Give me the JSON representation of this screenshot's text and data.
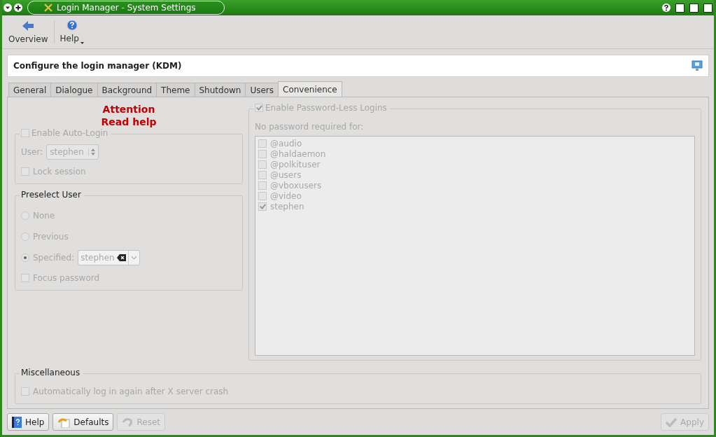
{
  "window": {
    "title": "Login Manager - System Settings"
  },
  "toolbar": [
    {
      "label": "Overview",
      "kind": "back"
    },
    {
      "label": "Help",
      "kind": "help"
    }
  ],
  "header": {
    "title": "Configure the login manager (KDM)"
  },
  "tabs": [
    {
      "label": "General",
      "selected": false
    },
    {
      "label": "Dialogue",
      "selected": false
    },
    {
      "label": "Background",
      "selected": false
    },
    {
      "label": "Theme",
      "selected": false
    },
    {
      "label": "Shutdown",
      "selected": false
    },
    {
      "label": "Users",
      "selected": false
    },
    {
      "label": "Convenience",
      "selected": true
    }
  ],
  "attention": [
    "Attention",
    "Read help"
  ],
  "auto_login": {
    "label": "Enable Auto-Login",
    "checked": false,
    "disabled": true,
    "user_label": "User:",
    "user_value": "stephen",
    "lock_session": {
      "label": "Lock session",
      "checked": false
    }
  },
  "preselect": {
    "title": "Preselect User",
    "disabled": true,
    "options": [
      {
        "label": "None",
        "selected": false
      },
      {
        "label": "Previous",
        "selected": false
      },
      {
        "label": "Specified:",
        "selected": true
      }
    ],
    "specified_value": "stephen",
    "focus_password": {
      "label": "Focus password",
      "checked": false
    }
  },
  "passwordless": {
    "label": "Enable Password-Less Logins",
    "checked": true,
    "disabled": true,
    "list_label": "No password required for:",
    "users": [
      {
        "name": "@audio",
        "checked": false
      },
      {
        "name": "@haldaemon",
        "checked": false
      },
      {
        "name": "@polkituser",
        "checked": false
      },
      {
        "name": "@users",
        "checked": false
      },
      {
        "name": "@vboxusers",
        "checked": false
      },
      {
        "name": "@video",
        "checked": false
      },
      {
        "name": "stephen",
        "checked": true
      }
    ]
  },
  "misc": {
    "title": "Miscellaneous",
    "disabled": true,
    "option": {
      "label": "Automatically log in again after X server crash",
      "checked": false
    }
  },
  "buttons": [
    {
      "label": "Help",
      "kind": "help",
      "disabled": false
    },
    {
      "label": "Defaults",
      "kind": "defaults",
      "disabled": false
    },
    {
      "label": "Reset",
      "kind": "reset",
      "disabled": true
    },
    {
      "label": "Apply",
      "kind": "apply",
      "disabled": true
    }
  ]
}
